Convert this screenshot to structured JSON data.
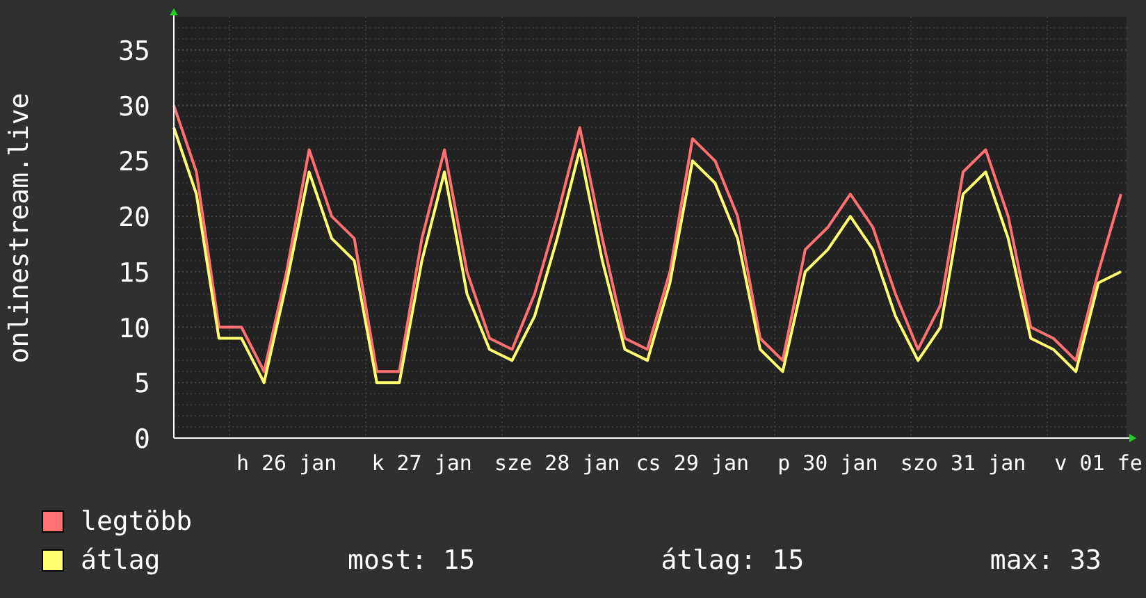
{
  "chart_data": {
    "type": "line",
    "ylabel": "onlinestream.live",
    "grid": true,
    "categories": [
      null,
      null,
      null,
      null,
      null,
      "h 26 jan",
      null,
      null,
      null,
      null,
      null,
      "k 27 jan",
      null,
      null,
      null,
      null,
      null,
      "sze 28 jan",
      null,
      null,
      null,
      null,
      null,
      "cs 29 jan",
      null,
      null,
      null,
      null,
      null,
      "p 30 jan",
      null,
      null,
      null,
      null,
      null,
      "szo 31 jan",
      null,
      null,
      null,
      null,
      null,
      "v 01 fe",
      null
    ],
    "ylim": [
      0,
      38
    ],
    "yticks": [
      0,
      5,
      10,
      15,
      20,
      25,
      30,
      35
    ],
    "series": [
      {
        "name": "legtöbb",
        "color": "#ff7070",
        "values": [
          30,
          24,
          10,
          10,
          6,
          15,
          26,
          20,
          18,
          6,
          6,
          18,
          26,
          15,
          9,
          8,
          13,
          20,
          28,
          18,
          9,
          8,
          15,
          27,
          25,
          20,
          9,
          7,
          17,
          19,
          22,
          19,
          13,
          8,
          12,
          24,
          26,
          20,
          10,
          9,
          7,
          15,
          22
        ]
      },
      {
        "name": "átlag",
        "color": "#ffff70",
        "values": [
          28,
          22,
          9,
          9,
          5,
          14,
          24,
          18,
          16,
          5,
          5,
          16,
          24,
          13,
          8,
          7,
          11,
          18,
          26,
          16,
          8,
          7,
          14,
          25,
          23,
          18,
          8,
          6,
          15,
          17,
          20,
          17,
          11,
          7,
          10,
          22,
          24,
          18,
          9,
          8,
          6,
          14,
          15
        ]
      }
    ]
  },
  "stats": [
    "most: 15",
    "átlag: 15",
    "max: 33"
  ]
}
